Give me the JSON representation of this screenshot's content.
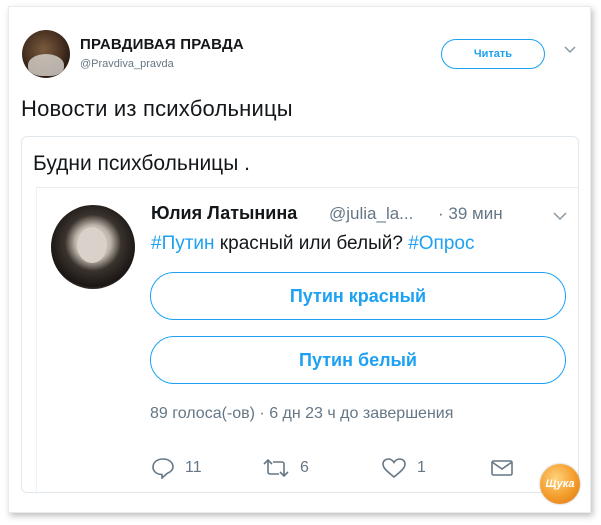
{
  "account": {
    "name": "ПРАВДИВАЯ ПРАВДА",
    "handle": "@Pravdiva_pravda",
    "follow_label": "Читать"
  },
  "tweet": {
    "text": "Новости из психбольницы"
  },
  "quoted": {
    "title": "Будни психбольницы ."
  },
  "inner_tweet": {
    "author_name": "Юлия Латынина",
    "author_handle": "@julia_la...",
    "time": "· 39 мин",
    "question_tag1": "#Путин",
    "question_mid": " красный или белый? ",
    "question_tag2": "#Опрос",
    "poll_options": [
      "Путин красный",
      "Путин белый"
    ],
    "poll_meta": "89 голоса(-ов) · 6 дн 23 ч до завершения"
  },
  "actions": {
    "reply_count": "11",
    "retweet_count": "6",
    "like_count": "1"
  },
  "watermark": "Щука",
  "colors": {
    "accent": "#1da1f2",
    "muted": "#657786",
    "text": "#14171a",
    "watermark": "#f39c2a"
  },
  "icons": [
    "reply-icon",
    "retweet-icon",
    "like-icon",
    "message-icon",
    "chevron-down-icon"
  ]
}
